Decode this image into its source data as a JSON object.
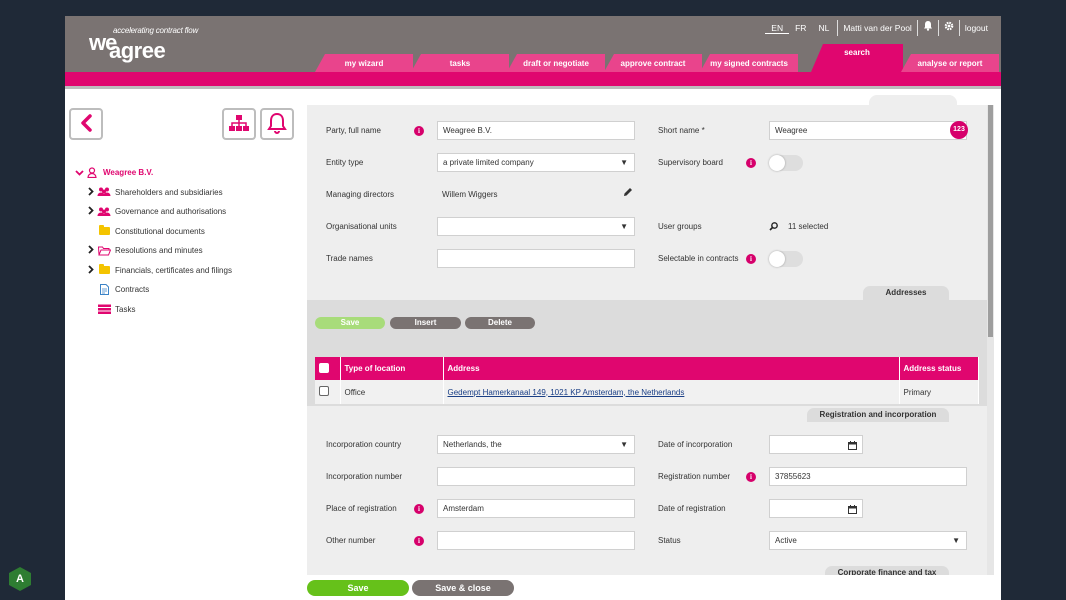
{
  "app": {
    "logo_we": "we",
    "logo_agree": "agree",
    "tagline": "accelerating contract flow"
  },
  "topbar": {
    "languages": [
      "EN",
      "FR",
      "NL"
    ],
    "active_language": "EN",
    "user": "Matti van der Pool",
    "logout": "logout"
  },
  "tabs": [
    {
      "label": "my wizard"
    },
    {
      "label": "tasks"
    },
    {
      "label": "draft or negotiate"
    },
    {
      "label": "approve contract"
    },
    {
      "label": "my signed contracts"
    },
    {
      "label": "search",
      "active": true
    },
    {
      "label": "analyse or report"
    }
  ],
  "tree": {
    "root": "Weagree B.V.",
    "items": [
      {
        "label": "Shareholders and subsidiaries",
        "icon": "people-icon",
        "expandable": true
      },
      {
        "label": "Governance and authorisations",
        "icon": "people-icon",
        "expandable": true
      },
      {
        "label": "Constitutional documents",
        "icon": "folder-icon",
        "expandable": false
      },
      {
        "label": "Resolutions and minutes",
        "icon": "open-folder-icon",
        "expandable": true
      },
      {
        "label": "Financials, certificates and filings",
        "icon": "folder-icon",
        "expandable": true
      },
      {
        "label": "Contracts",
        "icon": "document-icon",
        "expandable": false
      },
      {
        "label": "Tasks",
        "icon": "tasks-icon",
        "expandable": false
      }
    ]
  },
  "form": {
    "party_full_name_label": "Party, full name",
    "party_full_name": "Weagree B.V.",
    "short_name_label": "Short name *",
    "short_name": "Weagree",
    "short_name_badge": "123",
    "entity_type_label": "Entity type",
    "entity_type": "a private limited company",
    "supervisory_board_label": "Supervisory board",
    "managing_directors_label": "Managing directors",
    "managing_directors": "Willem Wiggers",
    "org_units_label": "Organisational units",
    "org_units": "",
    "user_groups_label": "User groups",
    "user_groups": "11 selected",
    "trade_names_label": "Trade names",
    "trade_names": "",
    "selectable_label": "Selectable in contracts"
  },
  "addresses": {
    "section_title": "Addresses",
    "save": "Save",
    "insert": "Insert",
    "delete": "Delete",
    "columns": [
      "Type of location",
      "Address",
      "Address status"
    ],
    "rows": [
      {
        "type": "Office",
        "address": "Gedempt Hamerkanaal 149, 1021 KP Amsterdam, the Netherlands",
        "status": "Primary"
      }
    ]
  },
  "registration": {
    "section_title": "Registration and incorporation",
    "inc_country_label": "Incorporation country",
    "inc_country": "Netherlands, the",
    "date_inc_label": "Date of incorporation",
    "date_inc": "",
    "inc_number_label": "Incorporation number",
    "inc_number": "",
    "reg_number_label": "Registration number",
    "reg_number": "37855623",
    "place_reg_label": "Place of registration",
    "place_reg": "Amsterdam",
    "date_reg_label": "Date of registration",
    "date_reg": "",
    "other_number_label": "Other number",
    "other_number": "",
    "status_label": "Status",
    "status": "Active"
  },
  "next_section": "Corporate finance and tax",
  "footer": {
    "save": "Save",
    "save_close": "Save & close"
  },
  "colors": {
    "brand_pink": "#e0066f",
    "header_gray": "#7a7372",
    "save_green": "#66c11a",
    "button_gray": "#7a7372"
  },
  "corner_badge": "A"
}
